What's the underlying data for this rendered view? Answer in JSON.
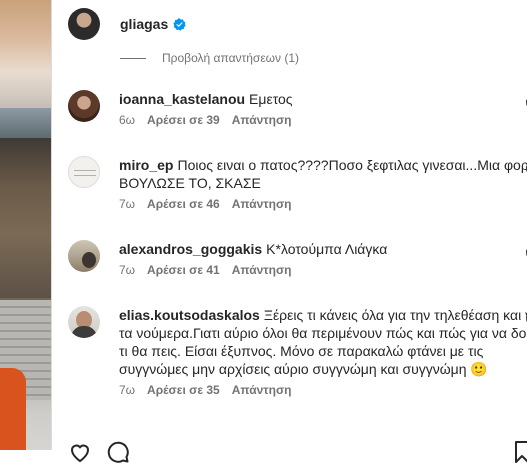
{
  "header": {
    "username": "gliagas",
    "verified": true
  },
  "view_replies": {
    "label": "Προβολή απαντήσεων (1)"
  },
  "comments": [
    {
      "username": "ioanna_kastelanou",
      "text": "Εμετος",
      "time": "6ω",
      "likes": "Αρέσει σε 39",
      "reply": "Απάντηση"
    },
    {
      "username": "miro_ep",
      "text": "Ποιος ειναι ο πατος????Ποσο ξεφτιλας γινεσαι...Μια φορα ΒΟΥΛΩΣΕ ΤΟ, ΣΚΑΣΕ",
      "time": "7ω",
      "likes": "Αρέσει σε 46",
      "reply": "Απάντηση"
    },
    {
      "username": "alexandros_goggakis",
      "text": "Κ*λοτούμπα Λιάγκα",
      "time": "7ω",
      "likes": "Αρέσει σε 41",
      "reply": "Απάντηση"
    },
    {
      "username": "elias.koutsodaskalos",
      "text": "Ξέρεις τι κάνεις όλα για την τηλεθέαση και για τα νούμερα.Γιατι αύριο όλοι θα περιμένουν πώς και πώς για να δουν τι θα πεις. Είσαι έξυπνος. Μόνο σε παρακαλώ φτάνει με τις συγγνώμες μην αρχίσεις αύριο συγγνώμη και συγγνώμη 🙂",
      "time": "7ω",
      "likes": "Αρέσει σε 35",
      "reply": "Απάντηση"
    }
  ],
  "colors": {
    "text": "#262626",
    "secondary": "#737373",
    "verified": "#0095f6"
  },
  "icons": [
    "verified-badge-icon",
    "heart-icon",
    "comment-icon",
    "bookmark-icon"
  ]
}
